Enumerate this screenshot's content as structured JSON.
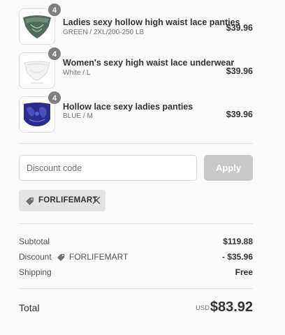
{
  "line_items": [
    {
      "name": "Ladies sexy hollow high waist lace panties",
      "variant": "GREEN / 2XL/200-250 LB",
      "price": "$39.96",
      "quantity": "4",
      "color": "#4f6b5a"
    },
    {
      "name": "Women's sexy high waist lace underwear",
      "variant": "White / L",
      "price": "$39.96",
      "quantity": "4",
      "color": "#f2f2f2"
    },
    {
      "name": "Hollow lace sexy ladies panties",
      "variant": "BLUE / M",
      "price": "$39.96",
      "quantity": "4",
      "color": "#2b2d8c"
    }
  ],
  "discount": {
    "placeholder": "Discount code",
    "apply_label": "Apply",
    "applied_code": "FORLIFEMART"
  },
  "summary": {
    "subtotal_label": "Subtotal",
    "subtotal_value": "$119.88",
    "discount_label": "Discount",
    "discount_code": "FORLIFEMART",
    "discount_value": "- $35.96",
    "shipping_label": "Shipping",
    "shipping_value": "Free"
  },
  "total": {
    "label": "Total",
    "currency": "USD",
    "value": "$83.92"
  },
  "colors": {
    "background": "#fafafa",
    "apply_button": "#c8c8c8",
    "tag_background": "#e4e4e4",
    "quantity_badge": "#7f7f7f"
  },
  "icons": {
    "tag": "tag-icon",
    "close": "close-icon"
  }
}
